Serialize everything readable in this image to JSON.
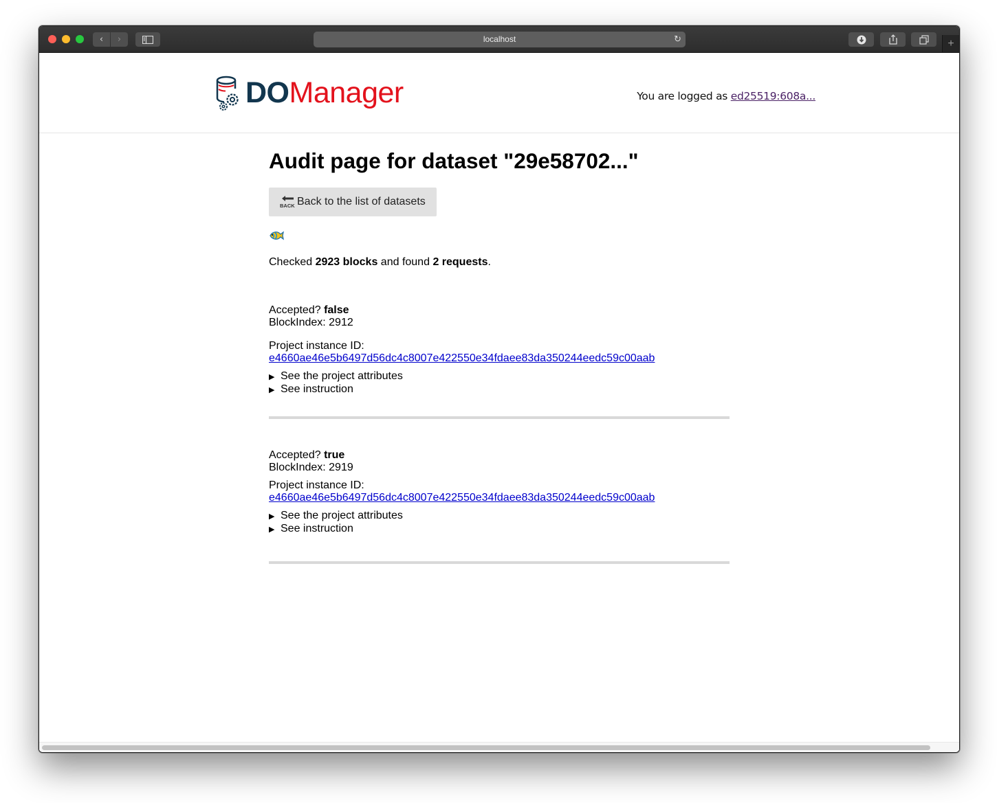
{
  "browser": {
    "address": "localhost",
    "reload_glyph": "↻",
    "back_glyph": "‹",
    "forward_glyph": "›",
    "new_tab_glyph": "+"
  },
  "header": {
    "logo_do": "DO",
    "logo_manager": "Manager",
    "login_prefix": "You are logged as",
    "login_user": "ed25519:608a..."
  },
  "page": {
    "title": "Audit page for dataset \"29e58702...\"",
    "back_button_label": "Back to the list of datasets",
    "back_icon_text": "BACK",
    "summary": {
      "checked_prefix": "Checked",
      "blocks": "2923 blocks",
      "found_text": "and found",
      "requests": "2 requests",
      "end": "."
    }
  },
  "requests": [
    {
      "accepted_label": "Accepted?",
      "accepted_value": "false",
      "block_index": "BlockIndex: 2912",
      "project_label": "Project instance ID:",
      "project_id": "e4660ae46e5b6497d56dc4c8007e422550e34fdaee83da350244eedc59c00aab",
      "attributes_toggle": "See the project attributes",
      "instruction_toggle": "See instruction"
    },
    {
      "accepted_label": "Accepted?",
      "accepted_value": "true",
      "block_index": "BlockIndex: 2919",
      "project_label": "Project instance ID:",
      "project_id": "e4660ae46e5b6497d56dc4c8007e422550e34fdaee83da350244eedc59c00aab",
      "attributes_toggle": "See the project attributes",
      "instruction_toggle": "See instruction"
    }
  ],
  "colors": {
    "logo_do": "#12364e",
    "logo_manager": "#e3121c",
    "link": "#0000cc",
    "separator": "#d9d9d9"
  },
  "icons": [
    "back-arrow-icon",
    "fish-icon",
    "reload-icon",
    "download-icon",
    "share-icon",
    "tabs-icon",
    "sidebar-icon"
  ]
}
